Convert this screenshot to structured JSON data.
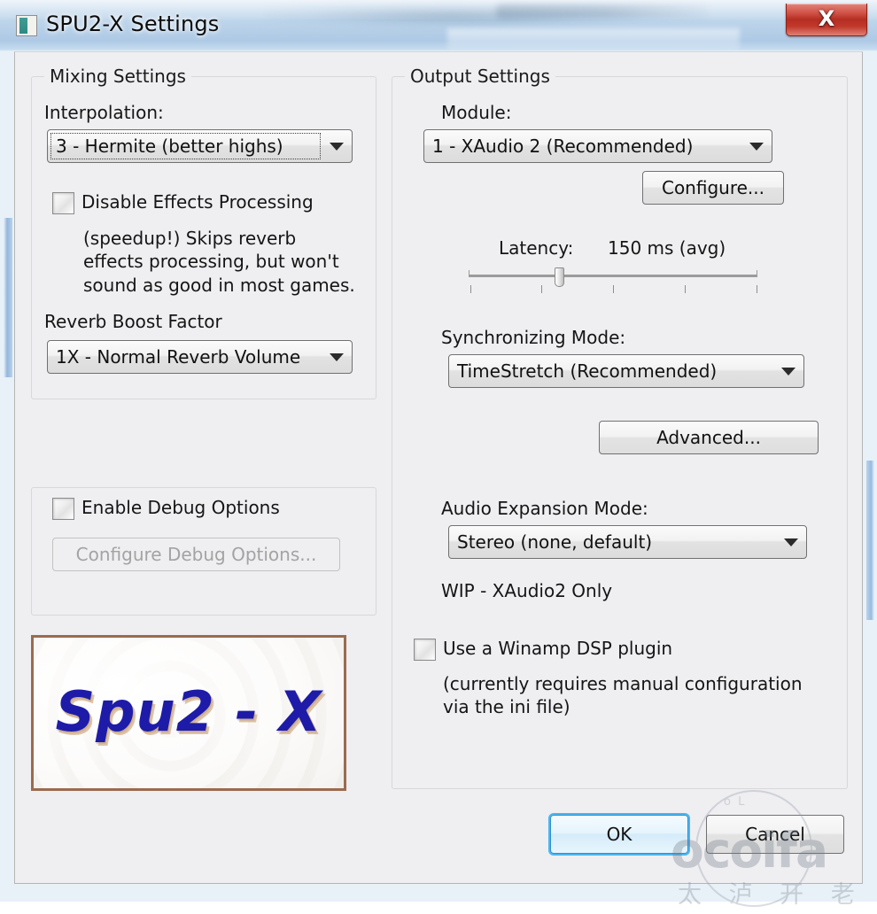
{
  "window": {
    "title": "SPU2-X Settings",
    "icon": "app-icon",
    "close_label": "X"
  },
  "mixing": {
    "group_title": "Mixing Settings",
    "interpolation_label": "Interpolation:",
    "interpolation_value": "3 - Hermite (better highs)",
    "disable_effects_label": "Disable Effects Processing",
    "disable_effects_checked": false,
    "disable_effects_help": "(speedup!) Skips reverb effects processing, but won't sound as good in most games.",
    "reverb_boost_label": "Reverb Boost Factor",
    "reverb_boost_value": "1X - Normal Reverb Volume"
  },
  "debug": {
    "enable_label": "Enable Debug Options",
    "enable_checked": false,
    "configure_label": "Configure Debug Options...",
    "configure_disabled": true
  },
  "logo": {
    "text": "Spu2 - X",
    "border_color": "#9a6b4f",
    "text_color": "#1d1ba8"
  },
  "output": {
    "group_title": "Output Settings",
    "module_label": "Module:",
    "module_value": "1 - XAudio 2 (Recommended)",
    "configure_label": "Configure...",
    "latency_label": "Latency:",
    "latency_value": "150 ms (avg)",
    "latency_ms": 150,
    "latency_percent": 31,
    "latency_ticks": 5,
    "sync_label": "Synchronizing Mode:",
    "sync_value": "TimeStretch (Recommended)",
    "advanced_label": "Advanced...",
    "expansion_label": "Audio Expansion Mode:",
    "expansion_value": "Stereo (none, default)",
    "expansion_note": "WIP - XAudio2 Only",
    "winamp_label": "Use a Winamp DSP plugin",
    "winamp_checked": false,
    "winamp_note": "(currently requires manual configuration via the ini file)"
  },
  "footer": {
    "ok_label": "OK",
    "cancel_label": "Cancel"
  },
  "watermark": {
    "brand": "ocoifa",
    "sub": "太 泸 开 老 回 网",
    "cap": "o L"
  }
}
